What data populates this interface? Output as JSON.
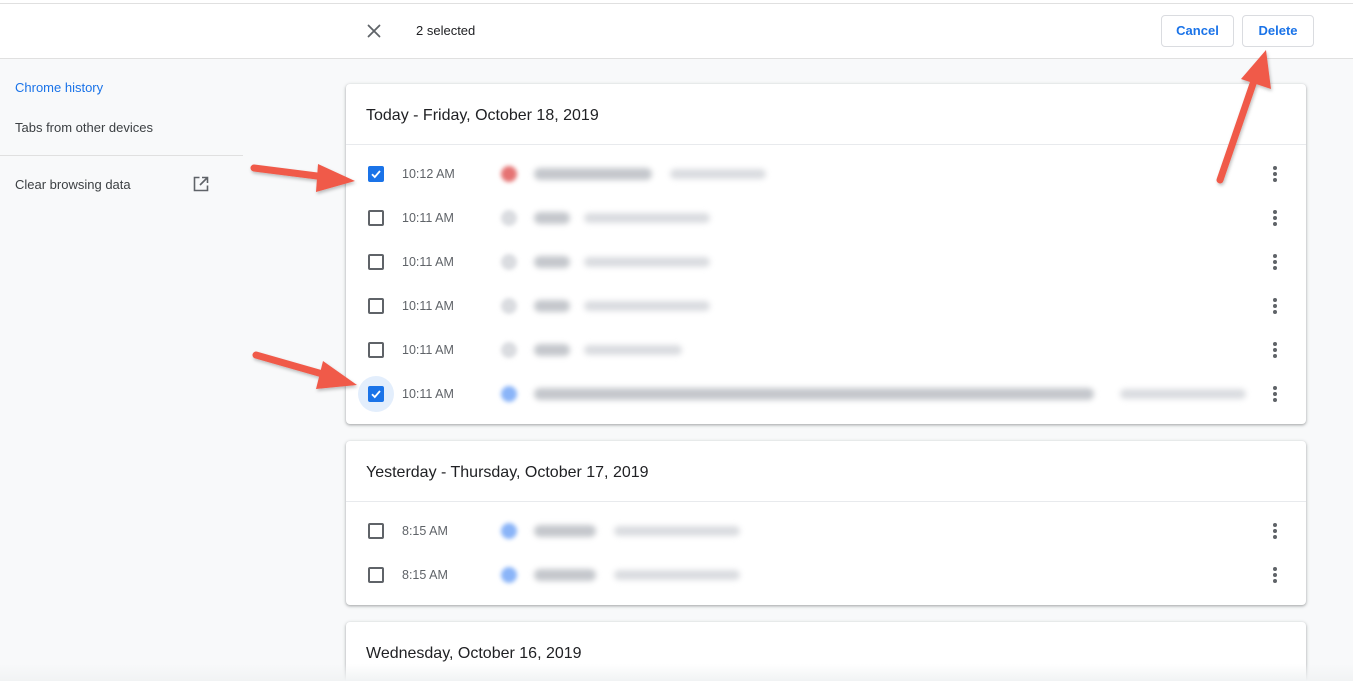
{
  "toolbar": {
    "selected_text": "2 selected",
    "cancel_label": "Cancel",
    "delete_label": "Delete"
  },
  "sidebar": {
    "items": [
      {
        "label": "Chrome history",
        "active": true
      },
      {
        "label": "Tabs from other devices",
        "active": false
      },
      {
        "label": "Clear browsing data",
        "active": false
      }
    ]
  },
  "groups": [
    {
      "header": "Today - Friday, October 18, 2019",
      "entries": [
        {
          "time": "10:12 AM",
          "checked": true
        },
        {
          "time": "10:11 AM",
          "checked": false
        },
        {
          "time": "10:11 AM",
          "checked": false
        },
        {
          "time": "10:11 AM",
          "checked": false
        },
        {
          "time": "10:11 AM",
          "checked": false
        },
        {
          "time": "10:11 AM",
          "checked": true
        }
      ]
    },
    {
      "header": "Yesterday - Thursday, October 17, 2019",
      "entries": [
        {
          "time": "8:15 AM",
          "checked": false
        },
        {
          "time": "8:15 AM",
          "checked": false
        }
      ]
    },
    {
      "header": "Wednesday, October 16, 2019",
      "entries": []
    }
  ],
  "colors": {
    "accent": "#1a73e8",
    "annotation_arrow": "#f05a4a"
  },
  "icons": {
    "close": "close-icon",
    "open_in_new": "open-in-new-icon",
    "more": "more-vertical-icon",
    "checkbox": "checkbox-icon"
  }
}
